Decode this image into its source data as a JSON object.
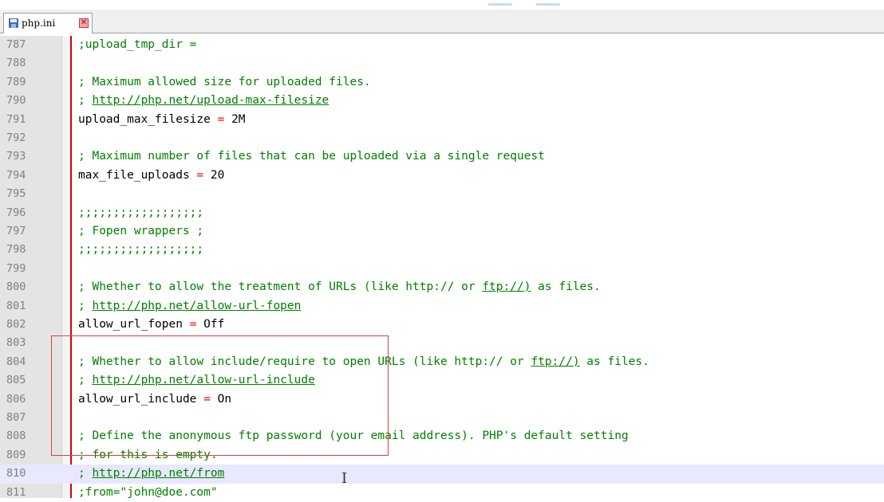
{
  "tab": {
    "label": "php.ini"
  },
  "lines": [
    {
      "n": "787",
      "tokens": [
        [
          "c",
          ";upload_tmp_dir"
        ],
        [
          "c",
          " ="
        ]
      ]
    },
    {
      "n": "788",
      "tokens": []
    },
    {
      "n": "789",
      "tokens": [
        [
          "c",
          "; Maximum allowed size for uploaded files."
        ]
      ]
    },
    {
      "n": "790",
      "tokens": [
        [
          "c",
          "; "
        ],
        [
          "l",
          "http://php.net/upload-max-filesize"
        ]
      ]
    },
    {
      "n": "791",
      "tokens": [
        [
          "k",
          "upload_max_filesize "
        ],
        [
          "o",
          "="
        ],
        [
          "v",
          " 2M"
        ]
      ]
    },
    {
      "n": "792",
      "tokens": []
    },
    {
      "n": "793",
      "tokens": [
        [
          "c",
          "; Maximum number of files that can be uploaded via a single request"
        ]
      ]
    },
    {
      "n": "794",
      "tokens": [
        [
          "k",
          "max_file_uploads "
        ],
        [
          "o",
          "="
        ],
        [
          "v",
          " 20"
        ]
      ]
    },
    {
      "n": "795",
      "tokens": []
    },
    {
      "n": "796",
      "tokens": [
        [
          "c",
          ";;;;;;;;;;;;;;;;;;"
        ]
      ]
    },
    {
      "n": "797",
      "tokens": [
        [
          "c",
          "; Fopen wrappers ;"
        ]
      ]
    },
    {
      "n": "798",
      "tokens": [
        [
          "c",
          ";;;;;;;;;;;;;;;;;;"
        ]
      ]
    },
    {
      "n": "799",
      "tokens": []
    },
    {
      "n": "800",
      "tokens": [
        [
          "c",
          "; Whether to allow the treatment of URLs (like http:// or "
        ],
        [
          "l",
          "ftp://)"
        ],
        [
          "c",
          " as files."
        ]
      ]
    },
    {
      "n": "801",
      "tokens": [
        [
          "c",
          "; "
        ],
        [
          "l",
          "http://php.net/allow-url-fopen"
        ]
      ]
    },
    {
      "n": "802",
      "tokens": [
        [
          "k",
          "allow_url_fopen "
        ],
        [
          "o",
          "="
        ],
        [
          "v",
          " Off"
        ]
      ]
    },
    {
      "n": "803",
      "tokens": []
    },
    {
      "n": "804",
      "tokens": [
        [
          "c",
          "; Whether to allow include/require to open URLs (like http:// or "
        ],
        [
          "l",
          "ftp://)"
        ],
        [
          "c",
          " as files."
        ]
      ]
    },
    {
      "n": "805",
      "tokens": [
        [
          "c",
          "; "
        ],
        [
          "l",
          "http://php.net/allow-url-include"
        ]
      ]
    },
    {
      "n": "806",
      "tokens": [
        [
          "k",
          "allow_url_include "
        ],
        [
          "o",
          "="
        ],
        [
          "v",
          " On"
        ]
      ]
    },
    {
      "n": "807",
      "tokens": []
    },
    {
      "n": "808",
      "tokens": [
        [
          "c",
          "; Define the anonymous ftp password (your email address). PHP's default setting"
        ]
      ]
    },
    {
      "n": "809",
      "tokens": [
        [
          "c",
          "; for this is empty."
        ]
      ]
    },
    {
      "n": "810",
      "tokens": [
        [
          "c",
          "; "
        ],
        [
          "l",
          "http://php.net/from"
        ]
      ],
      "current": true
    },
    {
      "n": "811",
      "tokens": [
        [
          "c",
          ";from=\"john@doe.com\""
        ]
      ]
    }
  ],
  "colors": {
    "comment": "#008000",
    "operator": "#ff0000",
    "highlight_box": "#d84040",
    "current_line": "#e8e8ff"
  },
  "icons": {
    "tab_icon": "save-icon",
    "tab_close": "close-icon",
    "cursor": "text-cursor-icon"
  },
  "caret_glyph": "I"
}
